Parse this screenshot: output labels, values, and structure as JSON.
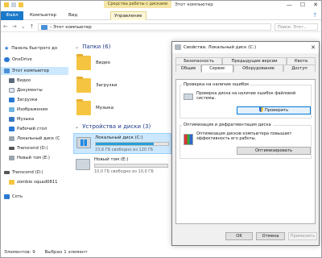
{
  "window": {
    "tools_label": "Средства работы с дисками",
    "title": "Этот компьютер"
  },
  "ribbon": {
    "tabs": [
      "Файл",
      "Компьютер",
      "Вид",
      "Управление"
    ]
  },
  "address": {
    "path": "›  Этот компьютер",
    "search_placeholder": "Поиск: Этот..."
  },
  "sidebar": {
    "items": [
      {
        "label": "Панель быстрого до"
      },
      {
        "label": "OneDrive"
      },
      {
        "label": "Этот компьютер"
      },
      {
        "label": "Видео"
      },
      {
        "label": "Документы"
      },
      {
        "label": "Загрузки"
      },
      {
        "label": "Изображения"
      },
      {
        "label": "Музыка"
      },
      {
        "label": "Рабочий стол"
      },
      {
        "label": "Локальный диск (С"
      },
      {
        "label": "Transcend (D:)"
      },
      {
        "label": "Новый том (E:)"
      },
      {
        "label": "Transcend (D:)"
      },
      {
        "label": "zombie squad0811"
      },
      {
        "label": "Сеть"
      }
    ]
  },
  "content": {
    "folders_header": "Папки (6)",
    "folders": [
      {
        "label": "Видео"
      },
      {
        "label": "Загрузки"
      },
      {
        "label": "Музыка"
      }
    ],
    "drives_header": "Устройства и диски (3)",
    "drives": [
      {
        "name": "Локальный диск (C:)",
        "free": "23,6 ГБ свободно из 120 ГБ",
        "used_fraction": 0.8
      },
      {
        "name": "Новый том (E:)",
        "free": "10,0 ГБ свободно из 10,0 ГБ",
        "used_fraction": 0.0
      }
    ]
  },
  "statusbar": {
    "count": "Элементов: 9",
    "selected": "Выбран 1 элемент"
  },
  "dialog": {
    "title": "Свойства: Локальный диск (C:)",
    "tabs_row1": [
      "Безопасность",
      "Предыдущие версии",
      "Квота"
    ],
    "tabs_row2": [
      "Общие",
      "Сервис",
      "Оборудование",
      "Доступ"
    ],
    "active_tab": "Сервис",
    "check": {
      "title": "Проверка на наличие ошибок",
      "text": "Проверка диска на наличие ошибок файловой системы.",
      "button": "Проверить"
    },
    "optimize": {
      "title": "Оптимизация и дефрагментация диска",
      "text": "Оптимизация дисков компьютера повышает эффективность его работы.",
      "button": "Оптимизировать"
    },
    "buttons": {
      "ok": "OK",
      "cancel": "Отмена",
      "apply": "Применить"
    }
  }
}
